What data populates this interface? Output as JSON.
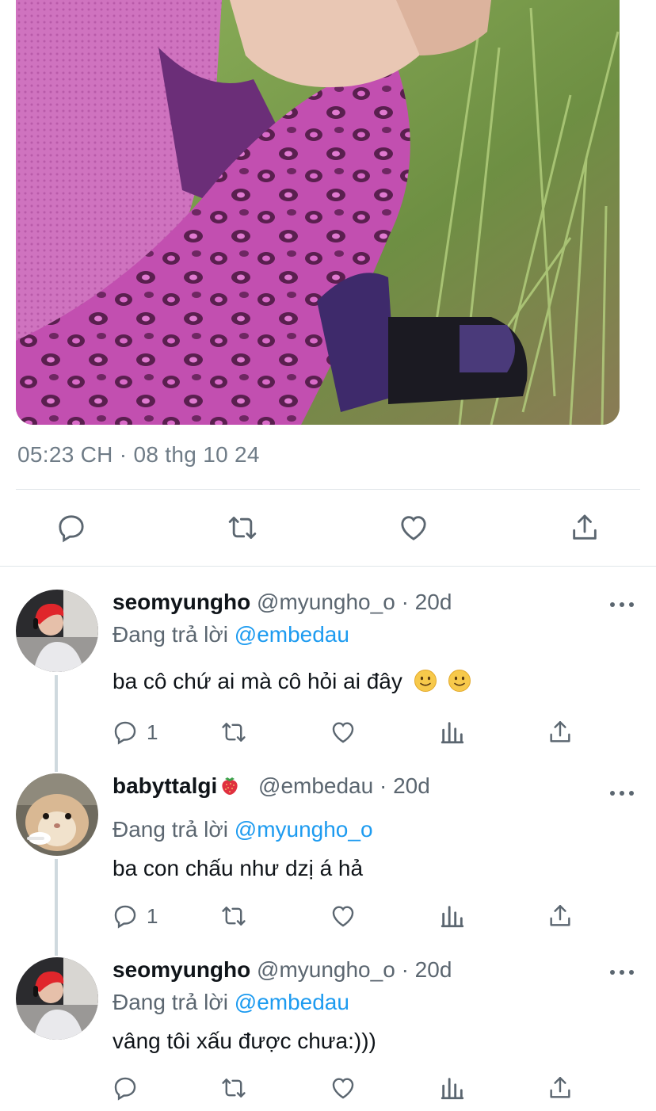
{
  "tweet": {
    "timestamp": "05:23 CH · 08 thg 10 24"
  },
  "main_actions": {
    "reply_icon": "reply-icon",
    "retweet_icon": "retweet-icon",
    "like_icon": "heart-icon",
    "share_icon": "share-icon"
  },
  "replies": [
    {
      "name": "seomyungho",
      "handle": "@myungho_o",
      "separator": "·",
      "age": "20d",
      "replying_prefix": "Đang trả lời",
      "replying_to": "@embedau",
      "text": "ba cô chứ ai mà cô hỏi ai đây",
      "reply_count": "1"
    },
    {
      "name": "babyttalgi",
      "handle": "@embedau",
      "separator": "·",
      "age": "20d",
      "replying_prefix": "Đang trả lời",
      "replying_to": "@myungho_o",
      "text": "ba con chấu như dzị á hả",
      "reply_count": "1"
    },
    {
      "name": "seomyungho",
      "handle": "@myungho_o",
      "separator": "·",
      "age": "20d",
      "replying_prefix": "Đang trả lời",
      "replying_to": "@embedau",
      "text": "vâng tôi xấu được chưa:)))",
      "reply_count": ""
    }
  ],
  "colors": {
    "accent": "#1d9bf0",
    "secondary_text": "#5b6670",
    "divider": "#e1e6ea"
  }
}
